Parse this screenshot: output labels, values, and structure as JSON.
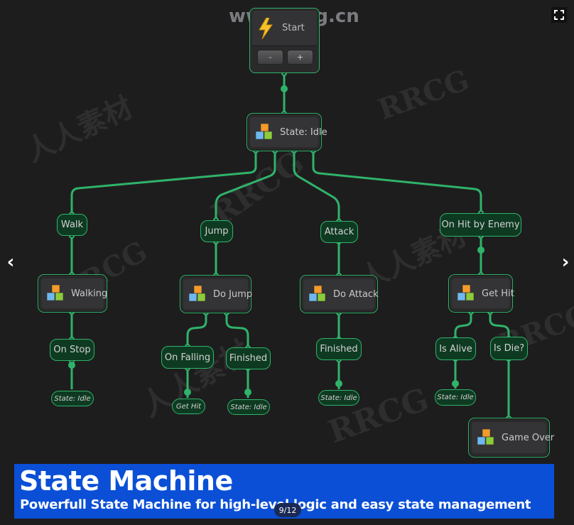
{
  "viewer": {
    "pager": "9/12",
    "prev_icon": "chevron-left-icon",
    "next_icon": "chevron-right-icon",
    "fullscreen_icon": "fullscreen-icon",
    "prev_glyph": "‹",
    "next_glyph": "›"
  },
  "watermark": {
    "url": "www.rrcg.cn",
    "texts": [
      "RRCG",
      "人人素材"
    ]
  },
  "colors": {
    "wire": "#2fb36a",
    "transition_fill": "#0f3a22",
    "state_fill": "#343436",
    "banner": "#0a4fd6",
    "background": "#1e1d1e"
  },
  "graph": {
    "start": {
      "label": "Start",
      "icon": "lightning-icon",
      "buttons": [
        "-",
        "+"
      ]
    },
    "idle": {
      "label": "State: Idle",
      "icon": "cubes-icon"
    },
    "branches": [
      {
        "transition": "Walk",
        "state": "Walking",
        "followups": [
          {
            "transition": "On Stop",
            "target": "State: Idle"
          }
        ]
      },
      {
        "transition": "Jump",
        "state": "Do Jump",
        "followups": [
          {
            "transition": "On Falling",
            "target": "Get Hit"
          },
          {
            "transition": "Finished",
            "target": "State: Idle"
          }
        ]
      },
      {
        "transition": "Attack",
        "state": "Do Attack",
        "followups": [
          {
            "transition": "Finished",
            "target": "State: Idle"
          }
        ]
      },
      {
        "transition": "On Hit by Enemy",
        "state": "Get Hit",
        "followups": [
          {
            "transition": "Is Alive",
            "target": "State: Idle"
          },
          {
            "transition": "Is Die?",
            "state": "Game Over"
          }
        ]
      }
    ]
  },
  "banner": {
    "title": "State Machine",
    "subtitle": "Powerfull State Machine for high-level logic and easy state management"
  }
}
